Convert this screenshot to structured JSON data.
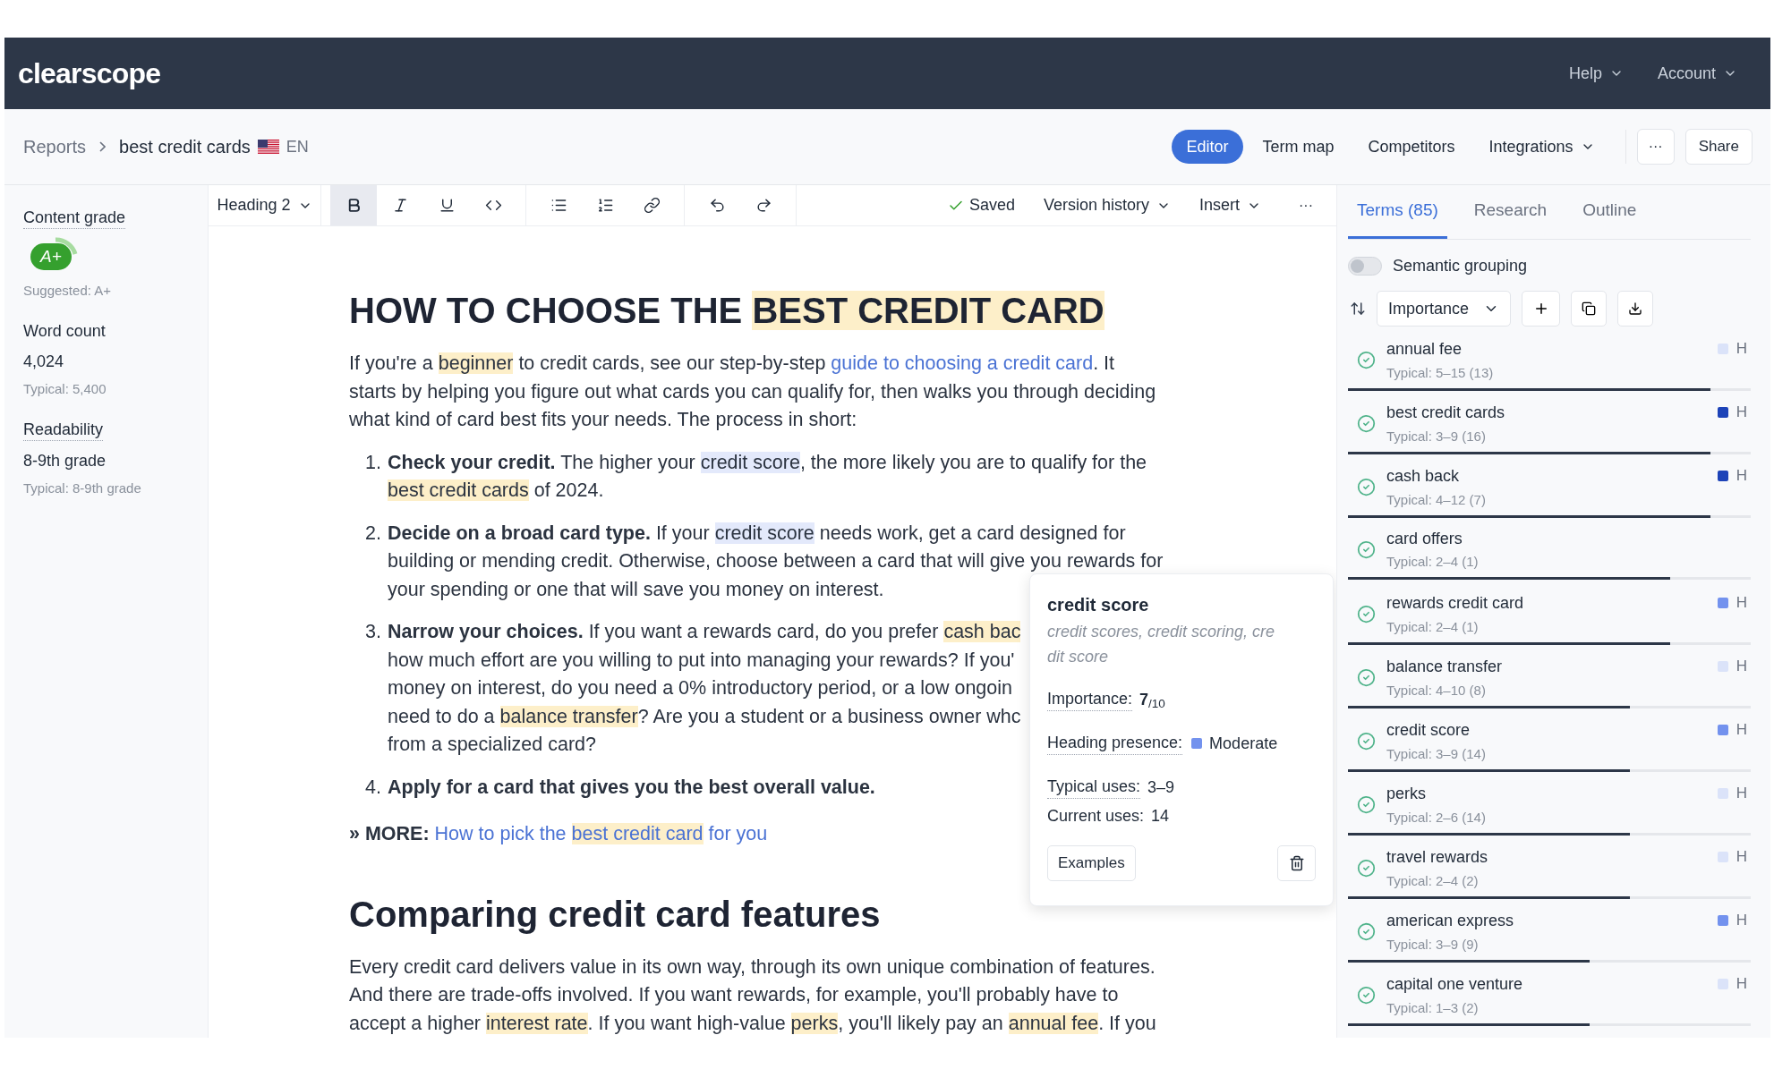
{
  "brand": {
    "logo": "clearscope"
  },
  "top_menu": [
    {
      "label": "Help"
    },
    {
      "label": "Account"
    }
  ],
  "breadcrumb": {
    "root": "Reports",
    "current": "best credit cards",
    "language": "EN"
  },
  "nav_tabs": [
    {
      "label": "Editor",
      "selected": true,
      "dropdown": false
    },
    {
      "label": "Term map",
      "selected": false,
      "dropdown": false
    },
    {
      "label": "Competitors",
      "selected": false,
      "dropdown": false
    },
    {
      "label": "Integrations",
      "selected": false,
      "dropdown": true
    }
  ],
  "header_actions": {
    "more": "···",
    "share": "Share"
  },
  "sidebar": {
    "sections": [
      {
        "kind": "grade",
        "label": "Content grade",
        "underlined": true,
        "grade": "A+",
        "note": "Suggested: A+"
      },
      {
        "kind": "value",
        "label": "Word count",
        "underlined": false,
        "value": "4,024",
        "note": "Typical: 5,400"
      },
      {
        "kind": "value",
        "label": "Readability",
        "underlined": true,
        "value": "8-9th grade",
        "note": "Typical: 8-9th grade"
      }
    ]
  },
  "toolbar": {
    "block_style": "Heading 2",
    "format_groups": [
      [
        {
          "kind": "bold",
          "active": true
        },
        {
          "kind": "italic",
          "active": false
        },
        {
          "kind": "underline",
          "active": false
        },
        {
          "kind": "code",
          "active": false
        }
      ],
      [
        {
          "kind": "bullet_list",
          "active": false
        },
        {
          "kind": "ordered_list",
          "active": false
        },
        {
          "kind": "link",
          "active": false
        }
      ],
      [
        {
          "kind": "undo",
          "active": false
        },
        {
          "kind": "redo",
          "active": false
        }
      ]
    ],
    "status": "Saved",
    "menus": [
      "Version history",
      "Insert"
    ],
    "more": "···"
  },
  "article": {
    "blocks": [
      {
        "kind": "h1",
        "lines": [
          [
            {
              "kind": "plain",
              "text": "HOW TO CHOOSE THE "
            },
            {
              "kind": "term",
              "text": "BEST CREDIT CARD"
            }
          ]
        ]
      },
      {
        "kind": "p",
        "lines": [
          [
            {
              "kind": "plain",
              "text": "If you're a "
            },
            {
              "kind": "term",
              "text": "beginner"
            },
            {
              "kind": "plain",
              "text": " to credit cards, see our step-by-step "
            },
            {
              "kind": "link",
              "parts": [
                {
                  "text": "guide to choosing a credit card",
                  "term": false
                }
              ]
            },
            {
              "kind": "plain",
              "text": ". It"
            }
          ],
          [
            {
              "kind": "plain",
              "text": "starts by helping you figure out what cards you can qualify for, then walks you through deciding"
            }
          ],
          [
            {
              "kind": "plain",
              "text": "what kind of card best fits your needs. The process in short:"
            }
          ]
        ]
      },
      {
        "kind": "ol",
        "items": [
          {
            "number": "1.",
            "lines": [
              [
                {
                  "kind": "bold",
                  "text": "Check your credit."
                },
                {
                  "kind": "plain",
                  "text": " The higher your "
                },
                {
                  "kind": "focus",
                  "text": "credit score"
                },
                {
                  "kind": "plain",
                  "text": ", the more likely you are to qualify for the"
                }
              ],
              [
                {
                  "kind": "term",
                  "text": "best credit cards"
                },
                {
                  "kind": "plain",
                  "text": " of 2024."
                }
              ]
            ]
          },
          {
            "number": "2.",
            "lines": [
              [
                {
                  "kind": "bold",
                  "text": "Decide on a broad card type."
                },
                {
                  "kind": "plain",
                  "text": " If your "
                },
                {
                  "kind": "focus",
                  "text": "credit score"
                },
                {
                  "kind": "plain",
                  "text": " needs work, get a card designed for"
                }
              ],
              [
                {
                  "kind": "plain",
                  "text": "building or mending credit. Otherwise, choose between a card that will give you rewards for"
                }
              ],
              [
                {
                  "kind": "plain",
                  "text": "your spending or one that will save you money on interest."
                }
              ]
            ]
          },
          {
            "number": "3.",
            "lines": [
              [
                {
                  "kind": "bold",
                  "text": "Narrow your choices."
                },
                {
                  "kind": "plain",
                  "text": " If you want a rewards card, do you prefer "
                },
                {
                  "kind": "term",
                  "text": "cash bac"
                }
              ],
              [
                {
                  "kind": "plain",
                  "text": "how much effort are you willing to put into managing your rewards? If you'"
                }
              ],
              [
                {
                  "kind": "plain",
                  "text": "money on interest, do you need a 0% introductory period, or a low ongoin"
                }
              ],
              [
                {
                  "kind": "plain",
                  "text": "need to do a "
                },
                {
                  "kind": "term",
                  "text": "balance transfer"
                },
                {
                  "kind": "plain",
                  "text": "? Are you a student or a business owner whc"
                }
              ],
              [
                {
                  "kind": "plain",
                  "text": "from a specialized card?"
                }
              ]
            ]
          },
          {
            "number": "4.",
            "lines": [
              [
                {
                  "kind": "bold",
                  "text": "Apply for a card that gives you the best overall value."
                }
              ]
            ]
          }
        ]
      },
      {
        "kind": "more",
        "lines": [
          [
            {
              "kind": "bold",
              "text": "» MORE: "
            },
            {
              "kind": "link",
              "parts": [
                {
                  "text": "How to pick the ",
                  "term": false
                },
                {
                  "text": "best credit card",
                  "term": true
                },
                {
                  "text": " for you",
                  "term": false
                }
              ]
            }
          ]
        ]
      },
      {
        "kind": "h2",
        "lines": [
          [
            {
              "kind": "plain",
              "text": "Comparing credit card features"
            }
          ]
        ]
      },
      {
        "kind": "p",
        "lines": [
          [
            {
              "kind": "plain",
              "text": "Every credit card delivers value in its own way, through its own unique combination of features."
            }
          ],
          [
            {
              "kind": "plain",
              "text": "And there are trade-offs involved. If you want rewards, for example, you'll probably have to"
            }
          ],
          [
            {
              "kind": "plain",
              "text": "accept a higher "
            },
            {
              "kind": "term",
              "text": "interest rate"
            },
            {
              "kind": "plain",
              "text": ". If you want high-value "
            },
            {
              "kind": "term",
              "text": "perks"
            },
            {
              "kind": "plain",
              "text": ", you'll likely pay an "
            },
            {
              "kind": "term",
              "text": "annual fee"
            },
            {
              "kind": "plain",
              "text": ". If you"
            }
          ]
        ]
      }
    ]
  },
  "popover": {
    "title": "credit score",
    "variants": "credit scores, credit scoring, credit score",
    "stats": [
      {
        "kind": "score",
        "label": "Importance:",
        "value": "**7**$_{/10}$",
        "underlined": true
      },
      {
        "kind": "presence",
        "label": "Heading presence:",
        "color": "#7392ee",
        "value": "Moderate",
        "underlined": true
      },
      {
        "kind": "count",
        "label": "Typical uses:",
        "value": "3–9",
        "underlined": true
      },
      {
        "kind": "count",
        "label": "Current uses:",
        "value": "14",
        "underlined": false
      }
    ],
    "button": "Examples"
  },
  "panel": {
    "tabs": [
      {
        "label": "Terms (85)",
        "selected": true
      },
      {
        "label": "Research",
        "selected": false
      },
      {
        "label": "Outline",
        "selected": false
      }
    ],
    "grouping": {
      "label": "Semantic grouping",
      "on": false
    },
    "sort": {
      "label": "Importance"
    },
    "terms": [
      {
        "name": "annual fee",
        "typical": "Typical: 5–15 (13)",
        "level": 0.9,
        "color": "#dbe3f9",
        "heading": "H"
      },
      {
        "name": "best credit cards",
        "typical": "Typical: 3–9 (16)",
        "level": 0.9,
        "color": "#1d43b8",
        "heading": "H"
      },
      {
        "name": "cash back",
        "typical": "Typical: 4–12 (7)",
        "level": 0.9,
        "color": "#1d43b8",
        "heading": "H"
      },
      {
        "name": "card offers",
        "typical": "Typical: 2–4 (1)",
        "level": 0.8
      },
      {
        "name": "rewards credit card",
        "typical": "Typical: 2–4 (1)",
        "level": 0.8,
        "color": "#7392ee",
        "heading": "H"
      },
      {
        "name": "balance transfer",
        "typical": "Typical: 4–10 (8)",
        "level": 0.7,
        "color": "#dbe3f9",
        "heading": "H"
      },
      {
        "name": "credit score",
        "typical": "Typical: 3–9 (14)",
        "level": 0.7,
        "color": "#7392ee",
        "heading": "H"
      },
      {
        "name": "perks",
        "typical": "Typical: 2–6 (14)",
        "level": 0.7,
        "color": "#dbe3f9",
        "heading": "H"
      },
      {
        "name": "travel rewards",
        "typical": "Typical: 2–4 (2)",
        "level": 0.7,
        "color": "#dbe3f9",
        "heading": "H"
      },
      {
        "name": "american express",
        "typical": "Typical: 3–9 (9)",
        "level": 0.6,
        "color": "#7392ee",
        "heading": "H"
      },
      {
        "name": "capital one venture",
        "typical": "Typical: 1–3 (2)",
        "level": 0.6,
        "color": "#dbe3f9",
        "heading": "H"
      }
    ]
  }
}
